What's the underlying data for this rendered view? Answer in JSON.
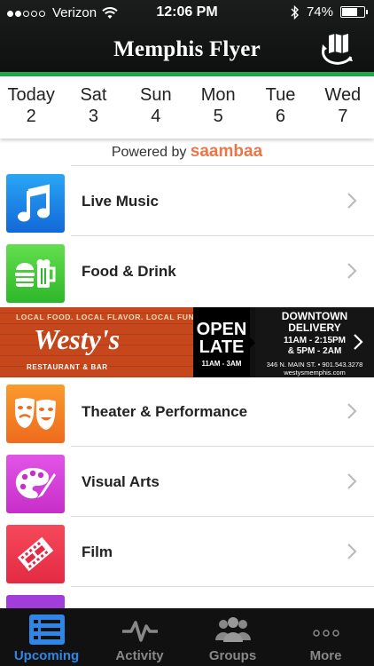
{
  "status_bar": {
    "carrier": "Verizon",
    "time": "12:06 PM",
    "battery": "74%",
    "battery_level": 0.74
  },
  "header": {
    "title": "Memphis Flyer",
    "map_icon": "map-refresh-icon"
  },
  "days": [
    {
      "name": "Today",
      "num": "2"
    },
    {
      "name": "Sat",
      "num": "3"
    },
    {
      "name": "Sun",
      "num": "4"
    },
    {
      "name": "Mon",
      "num": "5"
    },
    {
      "name": "Tue",
      "num": "6"
    },
    {
      "name": "Wed",
      "num": "7"
    }
  ],
  "powered_by": {
    "prefix": "Powered by",
    "brand": "saambaa"
  },
  "categories": [
    {
      "label": "Live Music",
      "icon": "music-note-icon",
      "color": "#1b78e8"
    },
    {
      "label": "Food & Drink",
      "icon": "food-drink-icon",
      "color": "#41c93c"
    },
    {
      "label": "Theater & Performance",
      "icon": "theater-masks-icon",
      "color": "#f07621"
    },
    {
      "label": "Visual Arts",
      "icon": "palette-icon",
      "color": "#d23dd7"
    },
    {
      "label": "Film",
      "icon": "film-icon",
      "color": "#ee3549"
    }
  ],
  "ad": {
    "tagline": "LOCAL FOOD. LOCAL FLAVOR. LOCAL FUN.",
    "name": "Westy's",
    "subtitle": "RESTAURANT & BAR",
    "open": "OPEN",
    "late": "LATE",
    "open_hours": "11AM - 3AM",
    "delivery_1": "DOWNTOWN",
    "delivery_2": "DELIVERY",
    "delivery_3": "11AM - 2:15PM",
    "delivery_4": "& 5PM - 2AM",
    "address": "346 N. MAIN ST. • 901.543.3278",
    "website": "westysmemphis.com"
  },
  "tabs": [
    {
      "label": "Upcoming",
      "icon": "list-icon",
      "active": true
    },
    {
      "label": "Activity",
      "icon": "activity-pulse-icon",
      "active": false
    },
    {
      "label": "Groups",
      "icon": "groups-icon",
      "active": false
    },
    {
      "label": "More",
      "icon": "more-dots-icon",
      "active": false
    }
  ],
  "colors": {
    "accent_green": "#21a84a",
    "tab_active": "#2f86e6",
    "brand_orange": "#e8774a"
  }
}
